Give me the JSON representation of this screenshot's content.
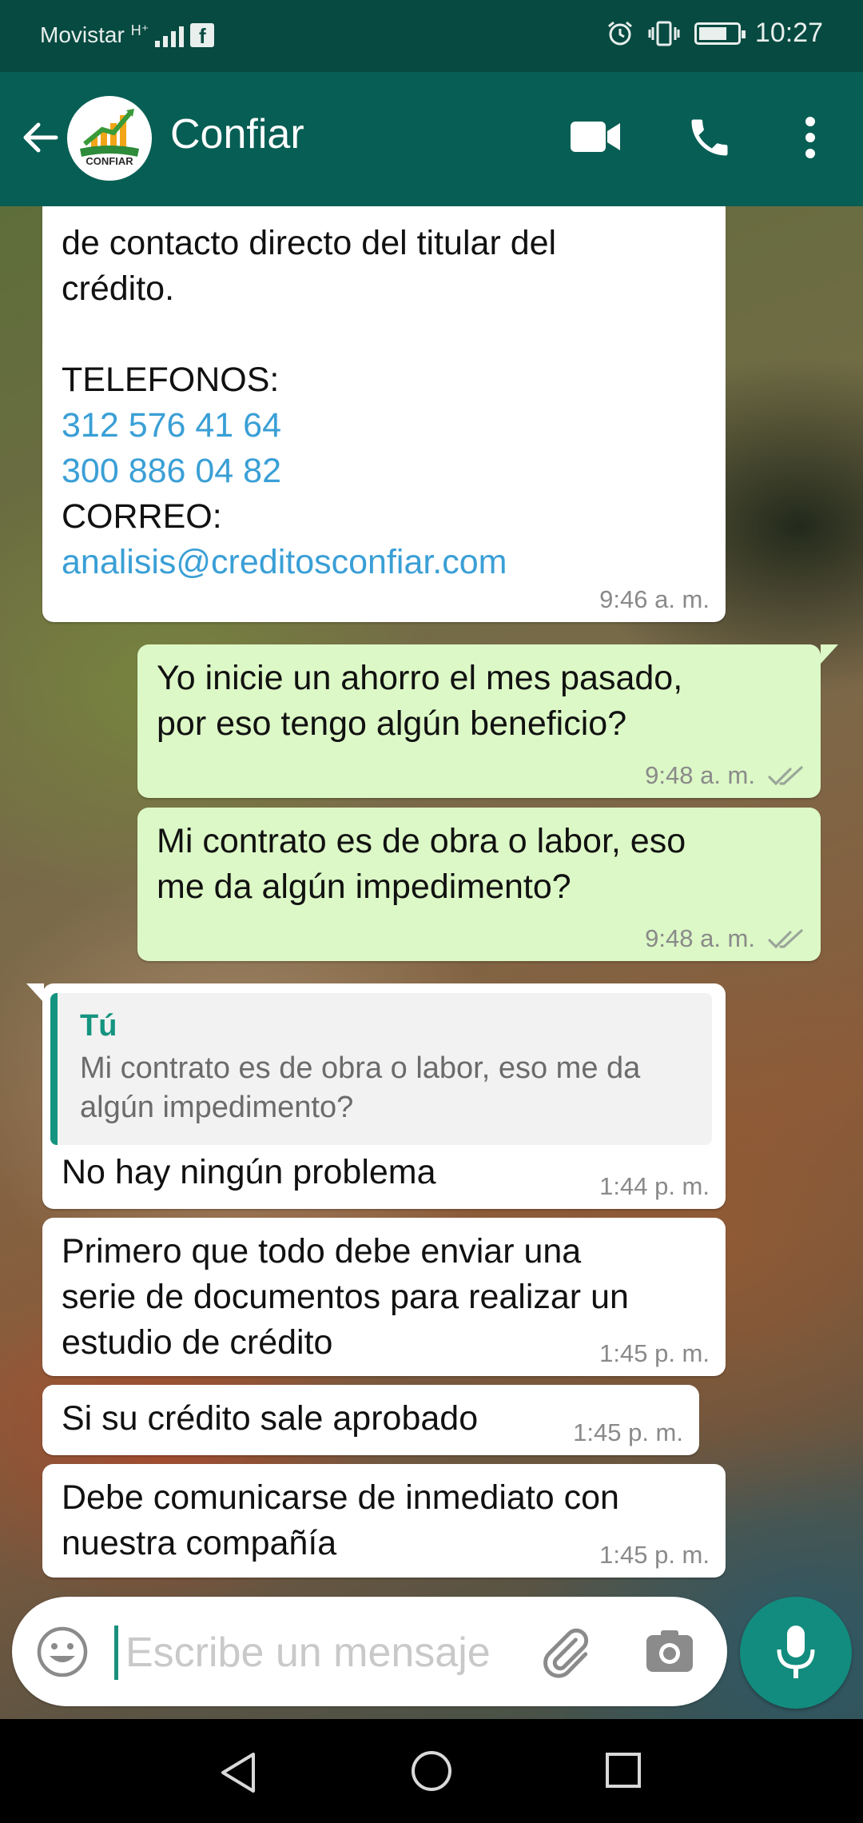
{
  "status_bar": {
    "carrier": "Movistar",
    "network": "H⁺",
    "time": "10:27",
    "icons": [
      "signal-icon",
      "facebook-icon",
      "alarm-icon",
      "vibrate-icon",
      "battery-icon"
    ]
  },
  "header": {
    "contact_name": "Confiar",
    "avatar_text": "CONFIAR",
    "icons": [
      "back-arrow-icon",
      "video-call-icon",
      "phone-icon",
      "more-vert-icon"
    ]
  },
  "messages": [
    {
      "direction": "in",
      "lines": [
        "de contacto directo del titular del",
        "crédito.",
        "",
        "TELEFONOS:"
      ],
      "links": [
        "312 576 41 64",
        "300 886 04 82"
      ],
      "after_label": "CORREO:",
      "email": "analisis@creditosconfiar.com",
      "time": "9:46 a. m."
    },
    {
      "direction": "out",
      "lines": [
        "Yo inicie un ahorro el mes pasado,",
        "por eso tengo algún beneficio?"
      ],
      "time": "9:48 a. m."
    },
    {
      "direction": "out",
      "lines": [
        "Mi contrato es de obra o labor, eso",
        "me da algún impedimento?"
      ],
      "time": "9:48 a. m."
    },
    {
      "direction": "in",
      "quote": {
        "author": "Tú",
        "lines": [
          "Mi contrato es de obra o labor, eso me da",
          "algún impedimento?"
        ]
      },
      "lines": [
        "No hay ningún problema"
      ],
      "time": "1:44 p. m."
    },
    {
      "direction": "in",
      "lines": [
        "Primero que todo debe enviar una",
        "serie de documentos para realizar un",
        "estudio de crédito"
      ],
      "time": "1:45 p. m."
    },
    {
      "direction": "in",
      "lines": [
        "Si su crédito sale aprobado"
      ],
      "time": "1:45 p. m."
    },
    {
      "direction": "in",
      "lines": [
        "Debe comunicarse de inmediato con",
        "nuestra compañía"
      ],
      "time": "1:45 p. m."
    }
  ],
  "composer": {
    "placeholder": "Escribe un mensaje",
    "value": "",
    "icons": [
      "emoji-icon",
      "attach-icon",
      "camera-icon",
      "mic-icon"
    ]
  },
  "colors": {
    "header": "#075e54",
    "status_bar": "#064a41",
    "outgoing_bubble": "#dcf8c6",
    "incoming_bubble": "#ffffff",
    "link": "#3a9fd6",
    "accent": "#128c7e"
  }
}
